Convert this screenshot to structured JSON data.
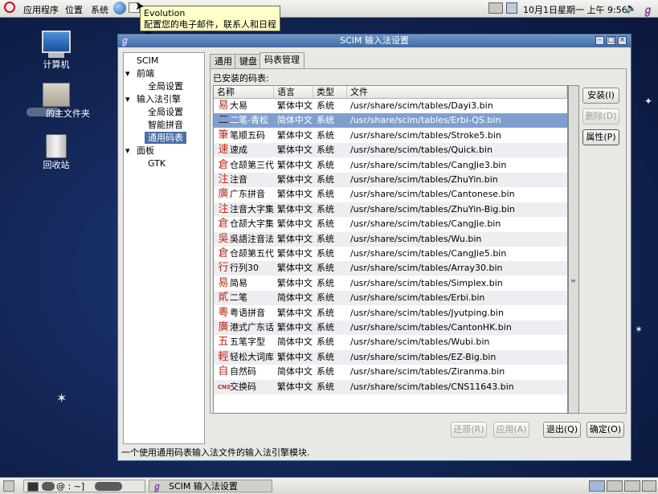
{
  "top_panel": {
    "menus": [
      "应用程序",
      "位置",
      "系统"
    ],
    "clock": "10月1日星期一  上午  9:56",
    "tooltip_title": "Evolution",
    "tooltip_text": "配置您的电子邮件，联系人和日程表"
  },
  "desktop_icons": [
    {
      "label": "计算机"
    },
    {
      "label": "的主文件夹"
    },
    {
      "label": "回收站"
    }
  ],
  "window": {
    "title": "SCIM 输入法设置",
    "tree": [
      "SCIM",
      "前端",
      "全局设置",
      "输入法引擎",
      "全局设置",
      "智能拼音",
      "通用码表",
      "面板",
      "GTK"
    ],
    "tabs": [
      "通用",
      "键盘",
      "码表管理"
    ],
    "installed_label": "已安装的码表:",
    "columns": [
      "名称",
      "语言",
      "类型",
      "文件"
    ],
    "rows": [
      {
        "icon": "易",
        "name": "大易",
        "lang": "繁体中文",
        "type": "系统",
        "file": "/usr/share/scim/tables/Dayi3.bin"
      },
      {
        "icon": "二",
        "name": "二笔-青松",
        "lang": "简体中文",
        "type": "系统",
        "file": "/usr/share/scim/tables/Erbi-QS.bin"
      },
      {
        "icon": "筆",
        "name": "笔顺五码",
        "lang": "繁体中文",
        "type": "系统",
        "file": "/usr/share/scim/tables/Stroke5.bin"
      },
      {
        "icon": "速",
        "name": "速成",
        "lang": "繁体中文",
        "type": "系统",
        "file": "/usr/share/scim/tables/Quick.bin"
      },
      {
        "icon": "倉",
        "name": "仓颉第三代",
        "lang": "繁体中文",
        "type": "系统",
        "file": "/usr/share/scim/tables/CangJie3.bin"
      },
      {
        "icon": "注",
        "name": "注音",
        "lang": "繁体中文",
        "type": "系统",
        "file": "/usr/share/scim/tables/ZhuYin.bin"
      },
      {
        "icon": "廣",
        "name": "广东拼音",
        "lang": "繁体中文",
        "type": "系统",
        "file": "/usr/share/scim/tables/Cantonese.bin"
      },
      {
        "icon": "注",
        "name": "注音大字集",
        "lang": "繁体中文",
        "type": "系统",
        "file": "/usr/share/scim/tables/ZhuYin-Big.bin"
      },
      {
        "icon": "倉",
        "name": "仓颉大字集",
        "lang": "繁体中文",
        "type": "系统",
        "file": "/usr/share/scim/tables/CangJie.bin"
      },
      {
        "icon": "吳",
        "name": "吳語注音法",
        "lang": "繁体中文",
        "type": "系统",
        "file": "/usr/share/scim/tables/Wu.bin"
      },
      {
        "icon": "倉",
        "name": "仓颉第五代",
        "lang": "繁体中文",
        "type": "系统",
        "file": "/usr/share/scim/tables/CangJie5.bin"
      },
      {
        "icon": "行",
        "name": "行列30",
        "lang": "繁体中文",
        "type": "系统",
        "file": "/usr/share/scim/tables/Array30.bin"
      },
      {
        "icon": "易",
        "name": "简易",
        "lang": "繁体中文",
        "type": "系统",
        "file": "/usr/share/scim/tables/Simplex.bin"
      },
      {
        "icon": "貳",
        "name": "二笔",
        "lang": "简体中文",
        "type": "系统",
        "file": "/usr/share/scim/tables/Erbi.bin"
      },
      {
        "icon": "粵",
        "name": "粤语拼音",
        "lang": "繁体中文",
        "type": "系统",
        "file": "/usr/share/scim/tables/Jyutping.bin"
      },
      {
        "icon": "廣",
        "name": "港式广东话",
        "lang": "繁体中文",
        "type": "系统",
        "file": "/usr/share/scim/tables/CantonHK.bin"
      },
      {
        "icon": "五",
        "name": "五笔字型",
        "lang": "简体中文",
        "type": "系统",
        "file": "/usr/share/scim/tables/Wubi.bin"
      },
      {
        "icon": "輕",
        "name": "轻松大词库",
        "lang": "繁体中文",
        "type": "系统",
        "file": "/usr/share/scim/tables/EZ-Big.bin"
      },
      {
        "icon": "自",
        "name": "自然码",
        "lang": "简体中文",
        "type": "系统",
        "file": "/usr/share/scim/tables/Ziranma.bin"
      },
      {
        "icon": "CNS",
        "name": "交换码",
        "lang": "繁体中文",
        "type": "系统",
        "file": "/usr/share/scim/tables/CNS11643.bin"
      }
    ],
    "side_buttons": {
      "install": "安装(I)",
      "delete": "删除(D)",
      "properties": "属性(P)"
    },
    "bottom_buttons": {
      "revert": "还原(R)",
      "apply": "应用(A)",
      "quit": "退出(Q)",
      "ok": "确定(O)"
    },
    "status": "一个使用通用码表输入法文件的输入法引擎模块."
  },
  "taskbar": {
    "terminal_label": "@          : ~]",
    "scim_label": "SCIM 输入法设置"
  },
  "colors": {
    "selection": "#7fa0cf",
    "titlebar": "#4f78b0",
    "icon_red": "#c0281a"
  }
}
